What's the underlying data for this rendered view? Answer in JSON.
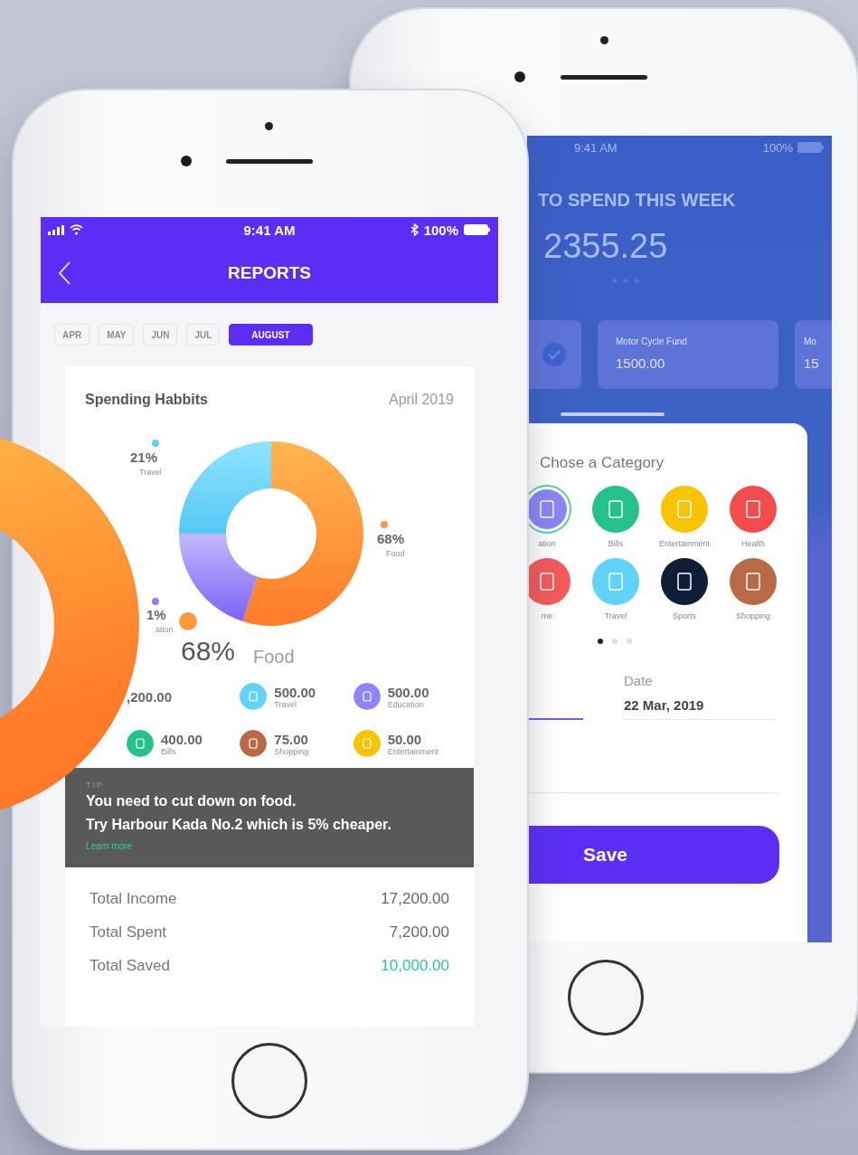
{
  "front_phone": {
    "status_bar": {
      "time": "9:41 AM",
      "battery": "100%"
    },
    "header": {
      "title": "REPORTS"
    },
    "months": [
      {
        "label": "APR",
        "selected": false
      },
      {
        "label": "MAY",
        "selected": false
      },
      {
        "label": "JUN",
        "selected": false
      },
      {
        "label": "JUL",
        "selected": false
      },
      {
        "label": "AUGUST",
        "selected": true
      }
    ],
    "card": {
      "title": "Spending Habbits",
      "period": "April 2019",
      "donut_labels": [
        {
          "percent": "21%",
          "category": "Travel",
          "color": "#5ccdf6"
        },
        {
          "percent": "68%",
          "category": "Food",
          "color": "#ff9a3c"
        },
        {
          "percent": "1%",
          "category": "ation",
          "color": "#8c7cf7"
        }
      ],
      "highlight": {
        "percent": "68%",
        "category": "Food",
        "color": "#ff9a3c"
      },
      "amounts": [
        {
          "amount": ",200.00"
        },
        {
          "amount": "500.00",
          "category": "Travel",
          "color": "#5fd3f8"
        },
        {
          "amount": "500.00",
          "category": "Education",
          "color": "#8a86f8"
        },
        {
          "amount": "400.00",
          "category": "Bills",
          "color": "#25c18a"
        },
        {
          "amount": "75.00",
          "category": "Shopping",
          "color": "#b86a47"
        },
        {
          "amount": "50.00",
          "category": "Entertainment",
          "color": "#f8c400"
        }
      ]
    },
    "tip": {
      "label": "TIP",
      "lines": [
        "You need to cut down on food.",
        "Try Harbour Kada No.2 which is 5% cheaper."
      ],
      "link": "Learn more"
    },
    "totals": [
      {
        "label": "Total Income",
        "value": "17,200.00",
        "kind": "plain"
      },
      {
        "label": "Total Spent",
        "value": "7,200.00",
        "kind": "plain"
      },
      {
        "label": "Total Saved",
        "value": "10,000.00",
        "kind": "positive"
      }
    ]
  },
  "back_phone": {
    "status_bar": {
      "time": "9:41 AM",
      "battery": "100%"
    },
    "budget": {
      "label": "TO SPEND THIS WEEK",
      "amount": "2355.25"
    },
    "funds": [
      {
        "selected": true
      },
      {
        "name": "Motor Cycle Fund",
        "amount": "1500.00",
        "selected": false
      },
      {
        "name": "Mo",
        "amount": "15",
        "selected": false
      }
    ],
    "category_sheet": {
      "title": "Chose a Category",
      "categories": [
        {
          "label": "ation",
          "color": "#8a86f8",
          "selected": true
        },
        {
          "label": "Bills",
          "color": "#25c18a",
          "selected": false
        },
        {
          "label": "Entertainment",
          "color": "#f8c400",
          "selected": false
        },
        {
          "label": "Health",
          "color": "#f44b4b",
          "selected": false
        },
        {
          "label": "me",
          "color": "#f45a5a",
          "selected": false
        },
        {
          "label": "Travel",
          "color": "#5fd3f8",
          "selected": false
        },
        {
          "label": "Sports",
          "color": "#0e1e36",
          "selected": false
        },
        {
          "label": "Shopping",
          "color": "#b86a47",
          "selected": false
        }
      ],
      "page_dots": [
        {
          "selected": true
        },
        {
          "selected": false
        },
        {
          "selected": false
        }
      ]
    },
    "form": {
      "date_label": "Date",
      "date_value": "22 Mar, 2019"
    },
    "save_button": "Save"
  }
}
